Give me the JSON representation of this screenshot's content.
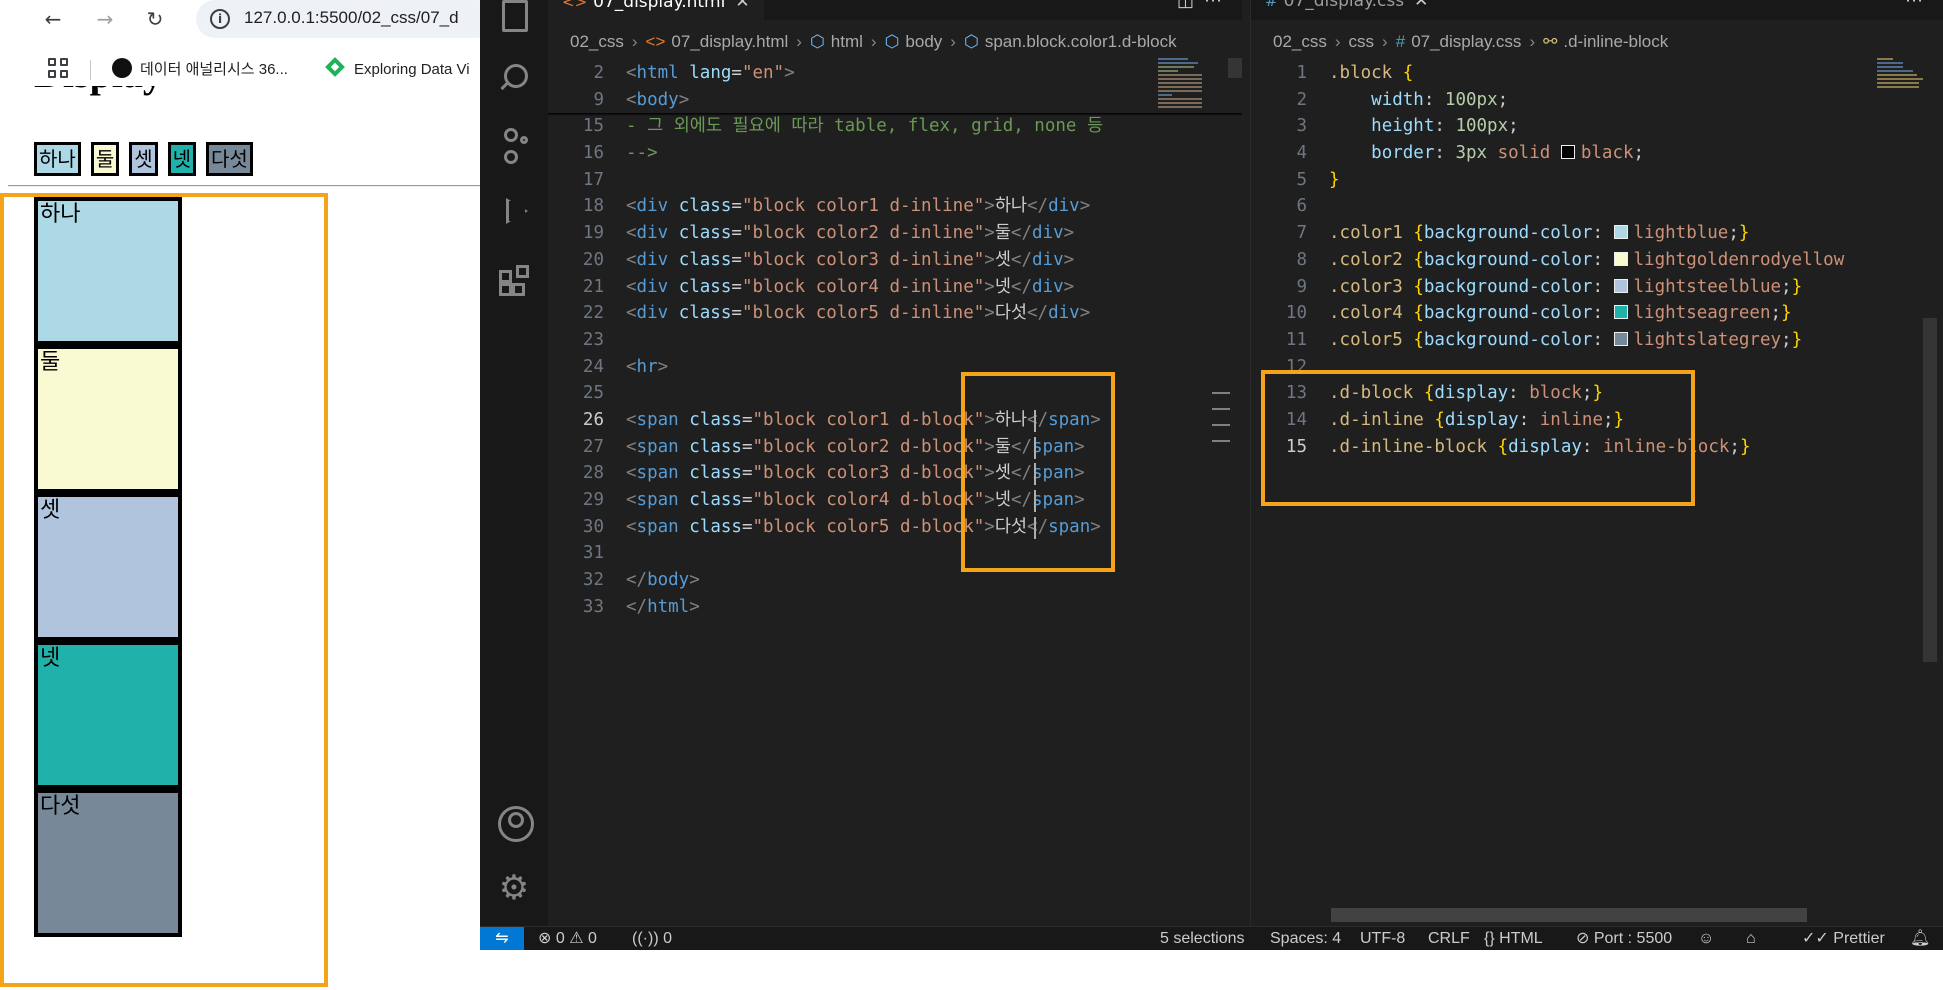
{
  "browser": {
    "url": "127.0.0.1:5500/02_css/07_d",
    "bookmarks": [
      {
        "label": "데이터 애널리시스 36..."
      },
      {
        "label": "Exploring Data Vi"
      }
    ],
    "heading": "Display",
    "inline_items": [
      "하나",
      "둘",
      "셋",
      "넷",
      "다섯"
    ],
    "block_items": [
      {
        "label": "하나",
        "color": "#add8e6"
      },
      {
        "label": "둘",
        "color": "#fafad2"
      },
      {
        "label": "셋",
        "color": "#b0c4de"
      },
      {
        "label": "넷",
        "color": "#20b2aa"
      },
      {
        "label": "다섯",
        "color": "#778899"
      }
    ],
    "inline_colors": [
      "#add8e6",
      "#fafad2",
      "#b0c4de",
      "#20b2aa",
      "#778899"
    ]
  },
  "editor_html": {
    "tab": "07_display.html",
    "breadcrumb": [
      "02_css",
      "07_display.html",
      "html",
      "body",
      "span.block.color1.d-block"
    ],
    "lines": [
      {
        "n": "2",
        "html": "<span class='t-br'>&lt;</span><span class='t-tag'>html</span> <span class='t-attr'>lang</span><span class='t-txt'>=</span><span class='t-str'>\"en\"</span><span class='t-br'>&gt;</span>"
      },
      {
        "n": "9",
        "html": "<span class='t-br'>&lt;</span><span class='t-tag'>body</span><span class='t-br'>&gt;</span>"
      },
      {
        "n": "15",
        "html": "<span class='t-com'>- 그 외에도 필요에 따라 table, flex, grid, none 등</span>"
      },
      {
        "n": "16",
        "html": "<span class='t-com'>--&gt;</span>"
      },
      {
        "n": "17",
        "html": ""
      },
      {
        "n": "18",
        "html": "<span class='t-br'>&lt;</span><span class='t-tag'>div</span> <span class='t-attr'>class</span><span class='t-txt'>=</span><span class='t-str'>\"block color1 d-inline\"</span><span class='t-br'>&gt;</span><span class='t-txt'>하나</span><span class='t-br'>&lt;/</span><span class='t-tag'>div</span><span class='t-br'>&gt;</span>"
      },
      {
        "n": "19",
        "html": "<span class='t-br'>&lt;</span><span class='t-tag'>div</span> <span class='t-attr'>class</span><span class='t-txt'>=</span><span class='t-str'>\"block color2 d-inline\"</span><span class='t-br'>&gt;</span><span class='t-txt'>둘</span><span class='t-br'>&lt;/</span><span class='t-tag'>div</span><span class='t-br'>&gt;</span>"
      },
      {
        "n": "20",
        "html": "<span class='t-br'>&lt;</span><span class='t-tag'>div</span> <span class='t-attr'>class</span><span class='t-txt'>=</span><span class='t-str'>\"block color3 d-inline\"</span><span class='t-br'>&gt;</span><span class='t-txt'>셋</span><span class='t-br'>&lt;/</span><span class='t-tag'>div</span><span class='t-br'>&gt;</span>"
      },
      {
        "n": "21",
        "html": "<span class='t-br'>&lt;</span><span class='t-tag'>div</span> <span class='t-attr'>class</span><span class='t-txt'>=</span><span class='t-str'>\"block color4 d-inline\"</span><span class='t-br'>&gt;</span><span class='t-txt'>넷</span><span class='t-br'>&lt;/</span><span class='t-tag'>div</span><span class='t-br'>&gt;</span>"
      },
      {
        "n": "22",
        "html": "<span class='t-br'>&lt;</span><span class='t-tag'>div</span> <span class='t-attr'>class</span><span class='t-txt'>=</span><span class='t-str'>\"block color5 d-inline\"</span><span class='t-br'>&gt;</span><span class='t-txt'>다섯</span><span class='t-br'>&lt;/</span><span class='t-tag'>div</span><span class='t-br'>&gt;</span>"
      },
      {
        "n": "23",
        "html": ""
      },
      {
        "n": "24",
        "html": "<span class='t-br'>&lt;</span><span class='t-tag'>hr</span><span class='t-br'>&gt;</span>"
      },
      {
        "n": "25",
        "html": ""
      },
      {
        "n": "26",
        "html": "<span class='t-br'>&lt;</span><span class='t-tag'>span</span> <span class='t-attr'>class</span><span class='t-txt'>=</span><span class='t-str'>\"block color1 d-block\"</span><span class='t-br'>&gt;</span><span class='t-txt'>하나</span><span class='t-br'>&lt;/</span><span class='t-tag'>span</span><span class='t-br'>&gt;</span>",
        "current": true
      },
      {
        "n": "27",
        "html": "<span class='t-br'>&lt;</span><span class='t-tag'>span</span> <span class='t-attr'>class</span><span class='t-txt'>=</span><span class='t-str'>\"block color2 d-block\"</span><span class='t-br'>&gt;</span><span class='t-txt'>둘</span><span class='t-br'>&lt;/</span><span class='t-tag'>span</span><span class='t-br'>&gt;</span>"
      },
      {
        "n": "28",
        "html": "<span class='t-br'>&lt;</span><span class='t-tag'>span</span> <span class='t-attr'>class</span><span class='t-txt'>=</span><span class='t-str'>\"block color3 d-block\"</span><span class='t-br'>&gt;</span><span class='t-txt'>셋</span><span class='t-br'>&lt;/</span><span class='t-tag'>span</span><span class='t-br'>&gt;</span>"
      },
      {
        "n": "29",
        "html": "<span class='t-br'>&lt;</span><span class='t-tag'>span</span> <span class='t-attr'>class</span><span class='t-txt'>=</span><span class='t-str'>\"block color4 d-block\"</span><span class='t-br'>&gt;</span><span class='t-txt'>넷</span><span class='t-br'>&lt;/</span><span class='t-tag'>span</span><span class='t-br'>&gt;</span>"
      },
      {
        "n": "30",
        "html": "<span class='t-br'>&lt;</span><span class='t-tag'>span</span> <span class='t-attr'>class</span><span class='t-txt'>=</span><span class='t-str'>\"block color5 d-block\"</span><span class='t-br'>&gt;</span><span class='t-txt'>다섯</span><span class='t-br'>&lt;/</span><span class='t-tag'>span</span><span class='t-br'>&gt;</span>"
      },
      {
        "n": "31",
        "html": ""
      },
      {
        "n": "32",
        "html": "<span class='t-br'>&lt;/</span><span class='t-tag'>body</span><span class='t-br'>&gt;</span>"
      },
      {
        "n": "33",
        "html": "<span class='t-br'>&lt;/</span><span class='t-tag'>html</span><span class='t-br'>&gt;</span>"
      }
    ]
  },
  "editor_css": {
    "tab": "07_display.css",
    "breadcrumb": [
      "02_css",
      "css",
      "07_display.css",
      ".d-inline-block"
    ],
    "lines": [
      {
        "n": "1",
        "html": "<span class='c-sel'>.block</span> <span class='c-br1'>{</span>"
      },
      {
        "n": "2",
        "html": "    <span class='c-prop'>width</span><span class='c-col'>: </span><span class='c-num'>100px</span><span class='c-col'>;</span>"
      },
      {
        "n": "3",
        "html": "    <span class='c-prop'>height</span><span class='c-col'>: </span><span class='c-num'>100px</span><span class='c-col'>;</span>"
      },
      {
        "n": "4",
        "html": "    <span class='c-prop'>border</span><span class='c-col'>: </span><span class='c-num'>3px</span> <span class='c-val'>solid</span> <span class='swatch' style='background:#000'></span><span class='c-val'>black</span><span class='c-col'>;</span>"
      },
      {
        "n": "5",
        "html": "<span class='c-br1'>}</span>"
      },
      {
        "n": "6",
        "html": ""
      },
      {
        "n": "7",
        "html": "<span class='c-sel'>.color1</span> <span class='c-br1'>{</span><span class='c-prop'>background-color</span><span class='c-col'>: </span><span class='swatch' style='background:#add8e6'></span><span class='c-val'>lightblue</span><span class='c-col'>;</span><span class='c-br1'>}</span>"
      },
      {
        "n": "8",
        "html": "<span class='c-sel'>.color2</span> <span class='c-br1'>{</span><span class='c-prop'>background-color</span><span class='c-col'>: </span><span class='swatch' style='background:#fafad2'></span><span class='c-val'>lightgoldenrodyellow</span>"
      },
      {
        "n": "9",
        "html": "<span class='c-sel'>.color3</span> <span class='c-br1'>{</span><span class='c-prop'>background-color</span><span class='c-col'>: </span><span class='swatch' style='background:#b0c4de'></span><span class='c-val'>lightsteelblue</span><span class='c-col'>;</span><span class='c-br1'>}</span>"
      },
      {
        "n": "10",
        "html": "<span class='c-sel'>.color4</span> <span class='c-br1'>{</span><span class='c-prop'>background-color</span><span class='c-col'>: </span><span class='swatch' style='background:#20b2aa'></span><span class='c-val'>lightseagreen</span><span class='c-col'>;</span><span class='c-br1'>}</span>"
      },
      {
        "n": "11",
        "html": "<span class='c-sel'>.color5</span> <span class='c-br1'>{</span><span class='c-prop'>background-color</span><span class='c-col'>: </span><span class='swatch' style='background:#778899'></span><span class='c-val'>lightslategrey</span><span class='c-col'>;</span><span class='c-br1'>}</span>"
      },
      {
        "n": "12",
        "html": ""
      },
      {
        "n": "13",
        "html": "<span class='c-sel'>.d-block</span> <span class='c-br1'>{</span><span class='c-prop'>display</span><span class='c-col'>: </span><span class='c-val'>block</span><span class='c-col'>;</span><span class='c-br1'>}</span>"
      },
      {
        "n": "14",
        "html": "<span class='c-sel'>.d-inline</span> <span class='c-br1'>{</span><span class='c-prop'>display</span><span class='c-col'>: </span><span class='c-val'>inline</span><span class='c-col'>;</span><span class='c-br1'>}</span>"
      },
      {
        "n": "15",
        "html": "<span class='c-sel'>.d-inline-block</span> <span class='c-br1'>{</span><span class='c-prop'>display</span><span class='c-col'>: </span><span class='c-val'>inline-block</span><span class='c-col'>;</span><span class='c-br1'>}</span>",
        "current": true
      }
    ]
  },
  "status": {
    "errors": "0",
    "warnings": "0",
    "ports": "0",
    "selections": "5 selections",
    "spaces": "Spaces: 4",
    "encoding": "UTF-8",
    "eol": "CRLF",
    "language": "HTML",
    "port": "Port : 5500",
    "prettier": "Prettier"
  },
  "colors": {
    "highlight": "#f6a31c",
    "editor_bg": "#1f1f1f",
    "accent": "#0078d4"
  }
}
